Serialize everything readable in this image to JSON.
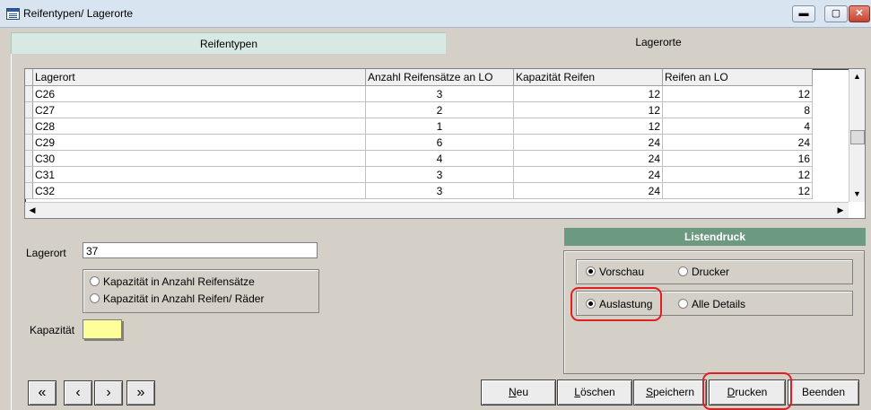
{
  "window": {
    "title": "Reifentypen/ Lagerorte",
    "min_label": "▬",
    "max_label": "▢",
    "close_label": "✕"
  },
  "tabs": [
    {
      "label": "Reifentypen"
    },
    {
      "label": "Lagerorte"
    }
  ],
  "grid": {
    "columns": [
      "Lagerort",
      "Anzahl Reifensätze an LO",
      "Kapazität Reifen",
      "Reifen an LO"
    ],
    "rows": [
      [
        "C26",
        "3",
        "12",
        "12"
      ],
      [
        "C27",
        "2",
        "12",
        "8"
      ],
      [
        "C28",
        "1",
        "12",
        "4"
      ],
      [
        "C29",
        "6",
        "24",
        "24"
      ],
      [
        "C30",
        "4",
        "24",
        "16"
      ],
      [
        "C31",
        "3",
        "24",
        "12"
      ],
      [
        "C32",
        "3",
        "24",
        "12"
      ]
    ]
  },
  "form": {
    "lagerort_label": "Lagerort",
    "lagerort_value": "37",
    "option_reifensaetze": "Kapazität in Anzahl Reifensätze",
    "option_reifen": "Kapazität in Anzahl Reifen/ Räder",
    "kapazitaet_label": "Kapazität"
  },
  "listendruck": {
    "header": "Listendruck",
    "vorschau": "Vorschau",
    "drucker": "Drucker",
    "auslastung": "Auslastung",
    "alle_details": "Alle Details",
    "selected_output": "Vorschau",
    "selected_type": "Auslastung"
  },
  "nav": {
    "first": "«",
    "prev": "‹",
    "next": "›",
    "last": "»"
  },
  "buttons": {
    "neu_acc": "N",
    "neu_rest": "eu",
    "loeschen_acc": "L",
    "loeschen_rest": "öschen",
    "speichern_acc": "S",
    "speichern_rest": "peichern",
    "drucken_acc": "D",
    "drucken_rest": "rucken",
    "beenden": "Beenden"
  }
}
